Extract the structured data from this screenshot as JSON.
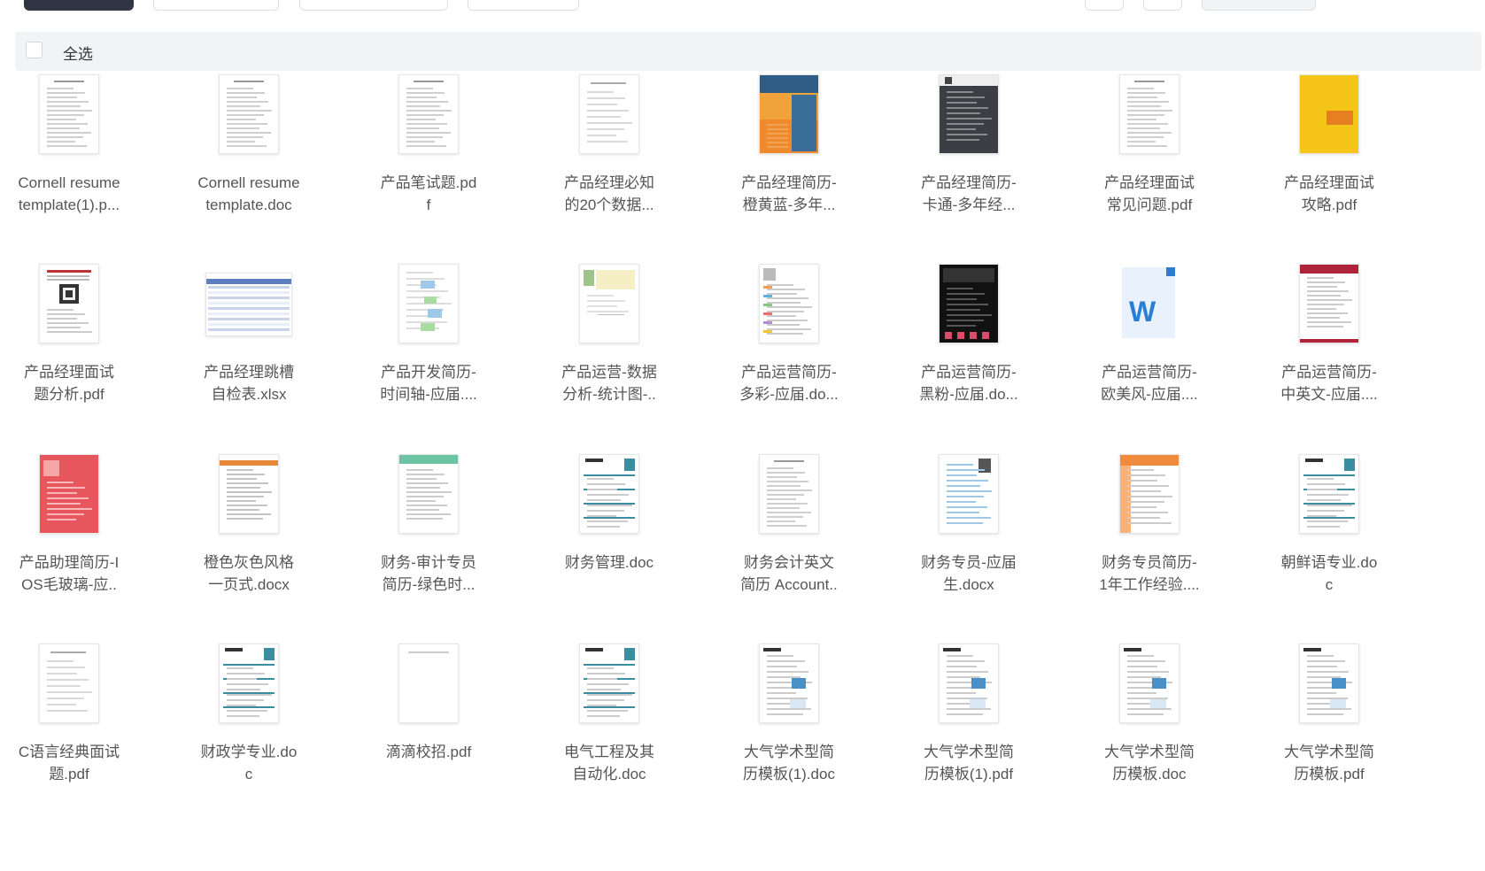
{
  "toolbar": {
    "buttons": [
      "",
      "",
      "",
      "",
      "",
      "",
      ""
    ]
  },
  "select_all": {
    "label": "全选",
    "checked": false
  },
  "files": [
    {
      "name": "Cornell resume\ntemplate(1).p...",
      "thumb": "doc-plain"
    },
    {
      "name": "Cornell resume\ntemplate.doc",
      "thumb": "doc-plain"
    },
    {
      "name": "产品笔试题.pd\nf",
      "thumb": "doc-plain"
    },
    {
      "name": "产品经理必知\n的20个数据...",
      "thumb": "doc-sparse"
    },
    {
      "name": "产品经理简历-\n橙黄蓝-多年...",
      "thumb": "resume-orange-blue"
    },
    {
      "name": "产品经理简历-\n卡通-多年经...",
      "thumb": "resume-dark"
    },
    {
      "name": "产品经理面试\n常见问题.pdf",
      "thumb": "doc-plain"
    },
    {
      "name": "产品经理面试\n攻略.pdf",
      "thumb": "cover-yellow"
    },
    {
      "name": "产品经理面试\n题分析.pdf",
      "thumb": "doc-qr"
    },
    {
      "name": "产品经理跳槽\n自检表.xlsx",
      "thumb": "sheet"
    },
    {
      "name": "产品开发简历-\n时间轴-应届....",
      "thumb": "resume-timeline"
    },
    {
      "name": "产品运营-数据\n分析-统计图-..",
      "thumb": "doc-chart"
    },
    {
      "name": "产品运营简历-\n多彩-应届.do...",
      "thumb": "resume-colorful"
    },
    {
      "name": "产品运营简历-\n黑粉-应届.do...",
      "thumb": "resume-black"
    },
    {
      "name": "产品运营简历-\n欧美风-应届....",
      "thumb": "word-icon"
    },
    {
      "name": "产品运营简历-\n中英文-应届....",
      "thumb": "resume-red-header"
    },
    {
      "name": "产品助理简历-I\nOS毛玻璃-应..",
      "thumb": "resume-red"
    },
    {
      "name": "橙色灰色风格\n一页式.docx",
      "thumb": "resume-orange-gray"
    },
    {
      "name": "财务-审计专员\n简历-绿色时...",
      "thumb": "resume-green"
    },
    {
      "name": "财务管理.doc",
      "thumb": "resume-teal"
    },
    {
      "name": "财务会计英文\n简历 Account..",
      "thumb": "doc-plain"
    },
    {
      "name": "财务专员-应届\n生.docx",
      "thumb": "resume-photo"
    },
    {
      "name": "财务专员简历-\n1年工作经验....",
      "thumb": "resume-orange-side"
    },
    {
      "name": "朝鲜语专业.do\nc",
      "thumb": "resume-teal"
    },
    {
      "name": "C语言经典面试\n题.pdf",
      "thumb": "doc-sparse"
    },
    {
      "name": "财政学专业.do\nc",
      "thumb": "resume-teal"
    },
    {
      "name": "滴滴校招.pdf",
      "thumb": "doc-blank"
    },
    {
      "name": "电气工程及其\n自动化.doc",
      "thumb": "resume-teal"
    },
    {
      "name": "大气学术型简\n历模板(1).doc",
      "thumb": "resume-academic"
    },
    {
      "name": "大气学术型简\n历模板(1).pdf",
      "thumb": "resume-academic"
    },
    {
      "name": "大气学术型简\n历模板.doc",
      "thumb": "resume-academic"
    },
    {
      "name": "大气学术型简\n历模板.pdf",
      "thumb": "resume-academic"
    }
  ],
  "colors": {
    "selbar_bg": "#f2f3f5",
    "text": "#555555",
    "word_blue": "#2b7cd3"
  }
}
